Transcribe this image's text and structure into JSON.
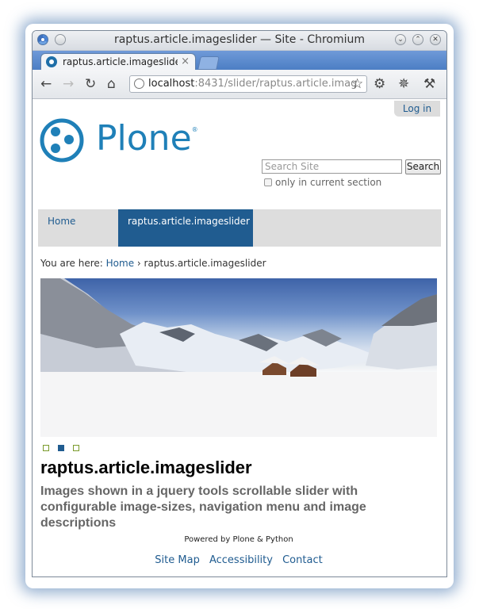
{
  "window": {
    "title": "raptus.article.imageslider — Site - Chromium",
    "buttons": {
      "minimize": "⌄",
      "maximize": "⌃",
      "close": "✕"
    }
  },
  "tab": {
    "title": "raptus.article.imageslider",
    "close": "×"
  },
  "toolbar": {
    "url_host": "localhost",
    "url_rest": ":8431/slider/raptus.article.imag",
    "icons": [
      "back-icon",
      "forward-icon",
      "reload-icon",
      "home-icon",
      "bookmark-star-icon",
      "extension-icon",
      "bug-icon",
      "wrench-icon"
    ]
  },
  "site": {
    "login": "Log in",
    "logo_text": "Plone",
    "logo_mark": "®",
    "search_placeholder": "Search Site",
    "search_button": "Search",
    "only_section_label": "only in current section",
    "brand_color": "#1f80b8",
    "link_color": "#205c90"
  },
  "nav": {
    "home": "Home",
    "active": "raptus.article.imageslider"
  },
  "breadcrumb": {
    "prefix": "You are here:",
    "home": "Home",
    "separator": "›",
    "current": "raptus.article.imageslider"
  },
  "slider": {
    "dots": 3,
    "active_dot": 2
  },
  "content": {
    "title": "raptus.article.imageslider",
    "description": "Images shown in a jquery tools scrollable slider with configurable image-sizes, navigation menu and image descriptions"
  },
  "footer": {
    "powered": "Powered by Plone & Python",
    "links": [
      "Site Map",
      "Accessibility",
      "Contact"
    ]
  }
}
